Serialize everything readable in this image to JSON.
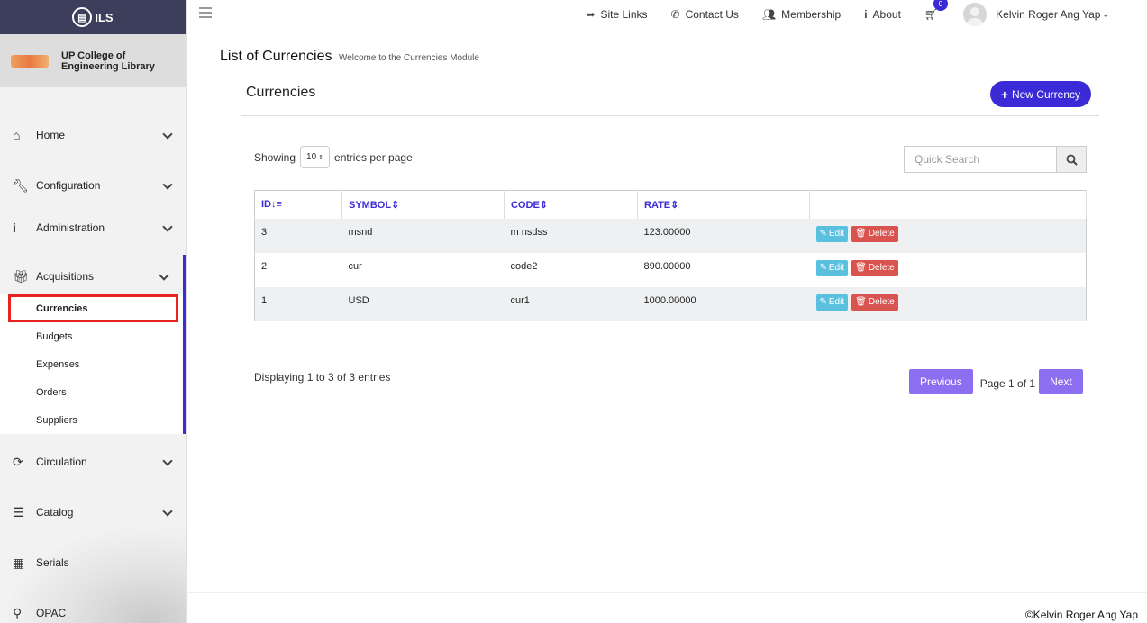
{
  "brand": {
    "name": "ILS"
  },
  "org": {
    "name": "UP College of Engineering Library"
  },
  "nav": {
    "home": "Home",
    "configuration": "Configuration",
    "administration": "Administration",
    "acquisitions": "Acquisitions",
    "sub": [
      "Currencies",
      "Budgets",
      "Expenses",
      "Orders",
      "Suppliers"
    ],
    "circulation": "Circulation",
    "catalog": "Catalog",
    "serials": "Serials",
    "opac": "OPAC"
  },
  "topbar": {
    "site_links": "Site Links",
    "contact_us": "Contact Us",
    "membership": "Membership",
    "about": "About",
    "cart_count": "0",
    "user_name": "Kelvin Roger Ang Yap"
  },
  "page": {
    "title": "List of Currencies",
    "subtitle": "Welcome to the Currencies Module",
    "card_title": "Currencies",
    "new_button": "New Currency"
  },
  "list": {
    "showing_label": "Showing",
    "per_page_value": "10",
    "per_page_suffix": "entries per page",
    "search_placeholder": "Quick Search",
    "columns": [
      "ID",
      "SYMBOL",
      "CODE",
      "RATE"
    ],
    "rows": [
      {
        "id": "3",
        "symbol": "msnd",
        "code": "m nsdss",
        "rate": "123.00000"
      },
      {
        "id": "2",
        "symbol": "cur",
        "code": "code2",
        "rate": "890.00000"
      },
      {
        "id": "1",
        "symbol": "USD",
        "code": "cur1",
        "rate": "1000.00000"
      }
    ],
    "edit_label": "Edit",
    "delete_label": "Delete",
    "displaying": "Displaying 1 to 3 of 3 entries",
    "previous": "Previous",
    "page_of": "Page 1 of 1",
    "next": "Next"
  },
  "footer": {
    "text": "©Kelvin Roger Ang Yap"
  }
}
